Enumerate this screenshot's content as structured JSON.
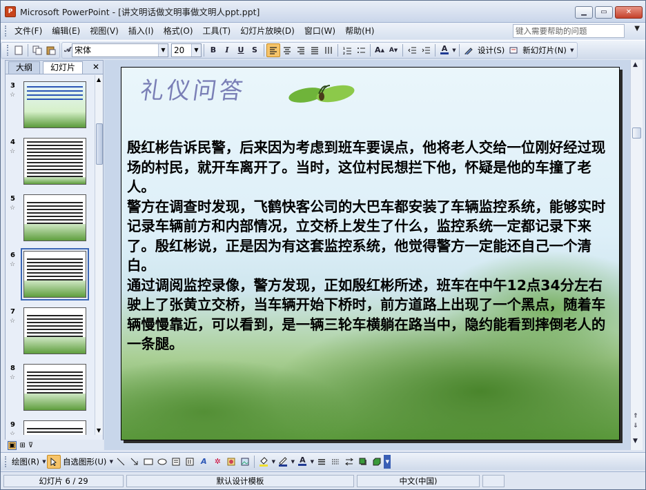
{
  "window": {
    "app_icon": "P",
    "title": "Microsoft PowerPoint - [讲文明话做文明事做文明人ppt.ppt]",
    "buttons": {
      "minimize": "▁",
      "maximize": "▭",
      "close": "✕"
    }
  },
  "menu": {
    "items": [
      "文件(F)",
      "编辑(E)",
      "视图(V)",
      "插入(I)",
      "格式(O)",
      "工具(T)",
      "幻灯片放映(D)",
      "窗口(W)",
      "帮助(H)"
    ],
    "help_placeholder": "键入需要帮助的问题"
  },
  "toolbar": {
    "font_name": "宋体",
    "font_size": "20",
    "bold": "B",
    "italic": "I",
    "underline": "U",
    "shadow": "S",
    "font_color_label": "A",
    "design_label": "设计(S)",
    "new_slide_label": "新幻灯片(N)"
  },
  "pane": {
    "tabs": [
      "大纲",
      "幻灯片"
    ],
    "close": "✕",
    "thumbnails": [
      {
        "num": "3"
      },
      {
        "num": "4"
      },
      {
        "num": "5"
      },
      {
        "num": "6",
        "selected": true
      },
      {
        "num": "7"
      },
      {
        "num": "8"
      },
      {
        "num": "9"
      }
    ]
  },
  "slide": {
    "title": "礼仪问答",
    "paragraphs": [
      "殷红彬告诉民警，后来因为考虑到班车要误点，他将老人交给一位刚好经过现场的村民，就开车离开了。当时，这位村民想拦下他，怀疑是他的车撞了老人。",
      "警方在调查时发现，飞鹤快客公司的大巴车都安装了车辆监控系统，能够实时记录车辆前方和内部情况，立交桥上发生了什么，监控系统一定都记录下来了。殷红彬说，正是因为有这套监控系统，他觉得警方一定能还自己一个清白。",
      "通过调阅监控录像，警方发现，正如殷红彬所述，班车在中午12点34分左右驶上了张黄立交桥，当车辆开始下桥时，前方道路上出现了一个黑点，随着车辆慢慢靠近，可以看到，是一辆三轮车横躺在路当中，隐约能看到摔倒老人的一条腿。"
    ]
  },
  "drawbar": {
    "draw_label": "绘图(R)",
    "autoshape_label": "自选图形(U)"
  },
  "status": {
    "slide_info": "幻灯片 6 / 29",
    "template": "默认设计模板",
    "language": "中文(中国)"
  },
  "colors": {
    "title_color": "#7a7fb6",
    "selection_highlight": "#f6c46a",
    "selected_thumb_border": "#3a66b5"
  }
}
